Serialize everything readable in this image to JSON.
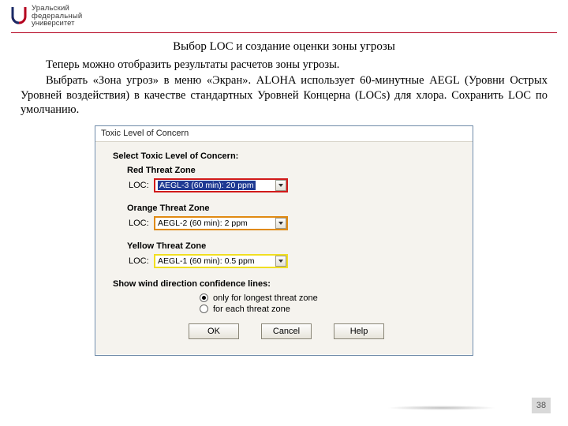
{
  "branding": {
    "line1": "Уральский",
    "line2": "федеральный",
    "line3": "университет"
  },
  "doc": {
    "title": "Выбор LOC и создание оценки зоны угрозы",
    "p1": "Теперь можно отобразить результаты расчетов зоны угрозы.",
    "p2": "Выбрать «Зона угроз» в меню «Экран». ALOHA использует 60-минутные AEGL (Уровни Острых Уровней воздействия) в качестве стандартных Уровней Концерна (LOCs) для хлора. Сохранить LOC по умолчанию.",
    "page_number": "38"
  },
  "dialog": {
    "title": "Toxic Level of Concern",
    "select_label": "Select Toxic Level of Concern:",
    "zones": {
      "red": {
        "label": "Red Threat Zone",
        "loc_label": "LOC:",
        "value": "AEGL-3 (60 min): 20 ppm"
      },
      "orange": {
        "label": "Orange Threat Zone",
        "loc_label": "LOC:",
        "value": "AEGL-2 (60 min): 2 ppm"
      },
      "yellow": {
        "label": "Yellow Threat Zone",
        "loc_label": "LOC:",
        "value": "AEGL-1 (60 min): 0.5 ppm"
      }
    },
    "wind_label": "Show wind direction confidence lines:",
    "radio1": "only for longest threat zone",
    "radio2": "for each threat zone",
    "buttons": {
      "ok": "OK",
      "cancel": "Cancel",
      "help": "Help"
    }
  }
}
